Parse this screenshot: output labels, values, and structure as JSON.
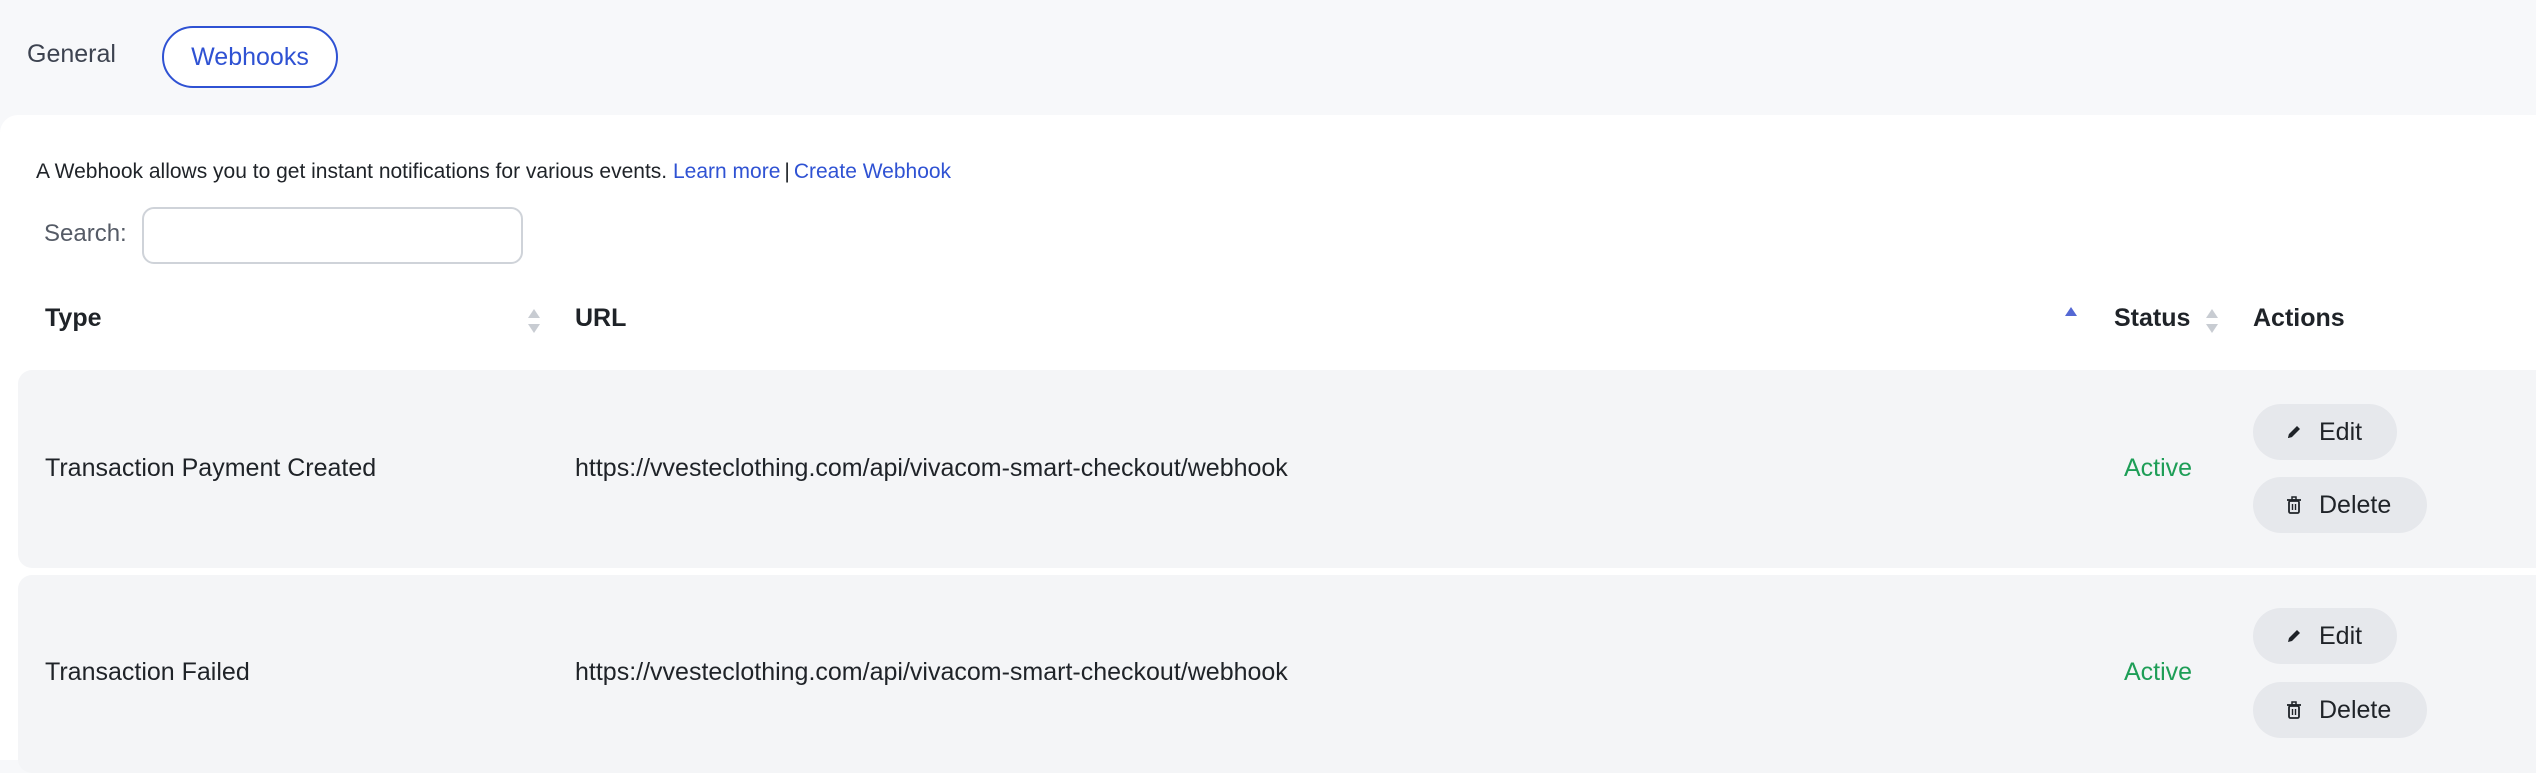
{
  "tabs": {
    "general": "General",
    "webhooks": "Webhooks"
  },
  "intro": {
    "text": "A Webhook allows you to get instant notifications for various events.",
    "learn_more": "Learn more",
    "separator": "|",
    "create_webhook": "Create Webhook"
  },
  "search": {
    "label": "Search:",
    "value": "",
    "placeholder": ""
  },
  "table": {
    "columns": {
      "type": "Type",
      "url": "URL",
      "status": "Status",
      "actions": "Actions"
    },
    "rows": [
      {
        "type": "Transaction Payment Created",
        "url": "https://vvesteclothing.com/api/vivacom-smart-checkout/webhook",
        "status": "Active",
        "edit": "Edit",
        "delete": "Delete"
      },
      {
        "type": "Transaction Failed",
        "url": "https://vvesteclothing.com/api/vivacom-smart-checkout/webhook",
        "status": "Active",
        "edit": "Edit",
        "delete": "Delete"
      }
    ]
  },
  "colors": {
    "accent": "#2f52d3",
    "status_active": "#1e9e57",
    "row_bg": "#f4f5f7",
    "button_bg": "#e6e8ec"
  },
  "icons": {
    "edit": "pencil-icon",
    "delete": "trash-icon",
    "sort": "sort-arrows-icon"
  }
}
